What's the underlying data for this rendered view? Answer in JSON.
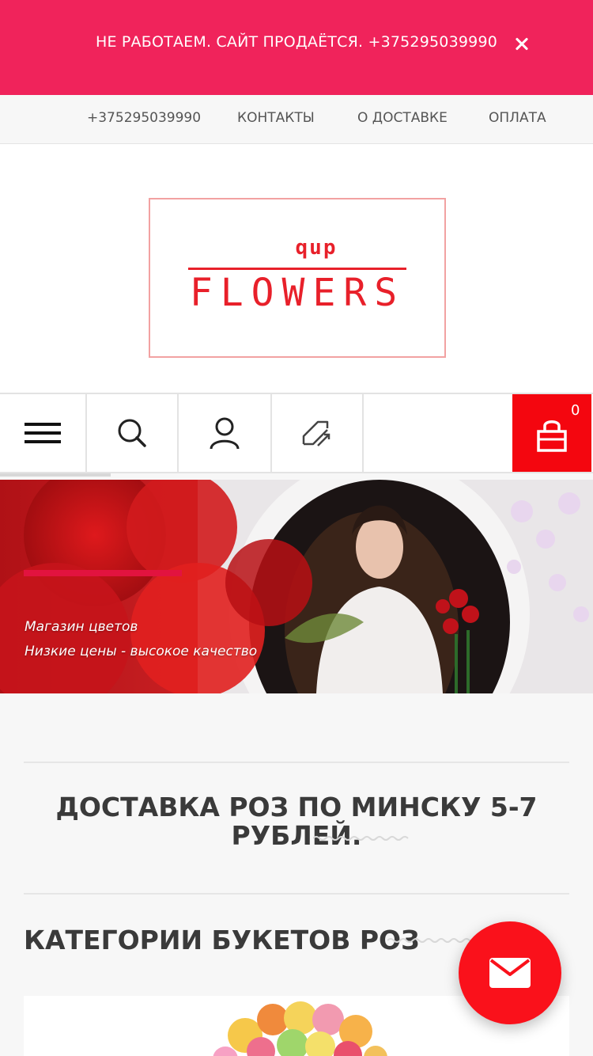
{
  "topbar": {
    "notice": "НЕ РАБОТАЕМ. САЙТ ПРОДАЁТСЯ. +375295039990",
    "close_icon": "close-icon",
    "color": "#f0235b"
  },
  "nav": {
    "phone": "+375295039990",
    "contacts": "КОНТАКТЫ",
    "delivery": "О ДОСТАВКЕ",
    "payment": "ОПЛАТА"
  },
  "logo": {
    "small": "qup",
    "big": "FLOWERS",
    "color": "#e8202a"
  },
  "toolbar": {
    "menu_icon": "hamburger-menu-icon",
    "search_icon": "search-icon",
    "account_icon": "user-icon",
    "compare_icon": "compare-icon",
    "cart_icon": "shopping-bag-icon",
    "cart_count": "0",
    "cart_color": "#f4060f"
  },
  "banner": {
    "line1": "Магазин цветов",
    "line2": "Низкие цены - высокое качество",
    "accent": "#e2133f"
  },
  "sections": {
    "delivery_heading": "ДОСТАВКА РОЗ ПО МИНСКУ 5-7 РУБЛЕЙ.",
    "categories_heading": "КАТЕГОРИИ БУКЕТОВ РОЗ"
  },
  "fab": {
    "icon": "mail-icon",
    "color": "#fa111b"
  }
}
